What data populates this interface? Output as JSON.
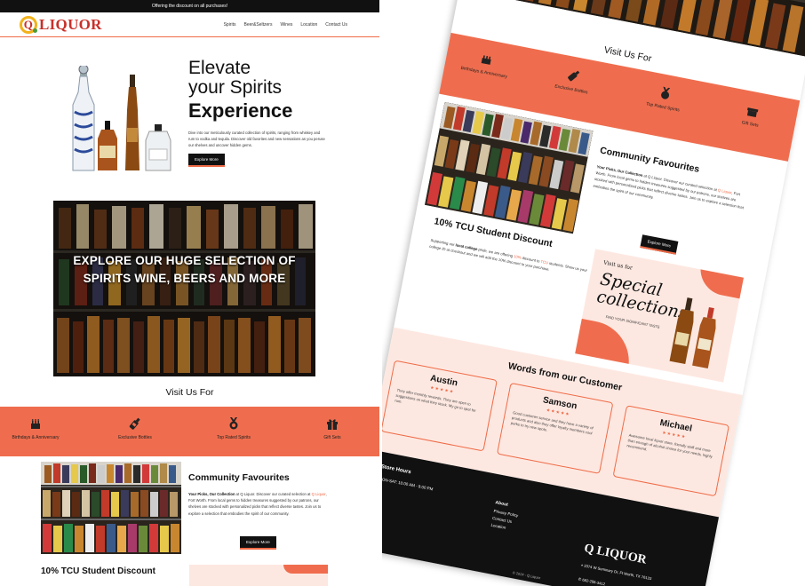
{
  "topbar": {
    "text": "Offering the discount on all purchases!"
  },
  "brand": {
    "name": "LIQUOR",
    "letter": "Q",
    "colors": {
      "accent": "#ef6d4e",
      "brand_red": "#c8302a",
      "dark": "#111111"
    }
  },
  "nav": [
    "Spirits",
    "Beer&Seltzers",
    "Wines",
    "Location",
    "Contact Us"
  ],
  "hero": {
    "line1": "Elevate",
    "line2": "your Spirits",
    "line3": "Experience",
    "body": "Dive into our meticulously curated collection of spirits, ranging from whiskey and rum to vodka and tequila. Discover old favorites and new sensations as you peruse our shelves and uncover hidden gems.",
    "button": "Explore More"
  },
  "banner": {
    "title": "EXPLORE OUR HUGE SELECTION OF SPIRITS WINE, BEERS AND MORE"
  },
  "visit": {
    "title": "Visit Us For",
    "items": [
      {
        "label": "Birthdays & Anniversary",
        "icon": "cake-icon"
      },
      {
        "label": "Exclusive Bottles",
        "icon": "bottle-icon"
      },
      {
        "label": "Top Rated Spirits",
        "icon": "medal-icon"
      },
      {
        "label": "Gift Sets",
        "icon": "gift-icon"
      }
    ]
  },
  "community": {
    "title": "Community Favourites",
    "lead": "Your Picks, Our Collection",
    "body_a": " at Q Liquor. Discover our curated selection at ",
    "link": "Q Liquor",
    "body_b": ", Fort Worth. From local gems to hidden treasures suggested by our patrons, our shelves are stocked with personalized picks that reflect diverse tastes. Join us to explore a selection that embodies the spirit of our community.",
    "button": "Explore More"
  },
  "tcu": {
    "title": "10% TCU Student Discount",
    "body_a": "Supporting our ",
    "bold": "local college",
    "body_b": " pride, we are offering ",
    "pct": "10%",
    "body_c": " discount to ",
    "link": "TCU",
    "body_d": " students. Show us your college ID at checkout and we will add the 10% discount to your purchase."
  },
  "special": {
    "kicker": "Visit us for",
    "title": "Special collections",
    "sub": "FIND YOUR SIGNIFICANT TASTE"
  },
  "testimonials": {
    "title": "Words from our Customer",
    "stars": "★★★★★",
    "items": [
      {
        "name": "Austin",
        "text": "They offer monthly rewards. They are open to suggestions on what they stock. My go to spot for rum."
      },
      {
        "name": "Samson",
        "text": "Good customer service and they have a variety of products and also they offer loyalty members cool perks to try new spots."
      },
      {
        "name": "Michael",
        "text": "Awesome local liquor store, friendly staff and more than enough of alcohol choice for your needs, highly recommend."
      }
    ]
  },
  "footer": {
    "hours_title": "Store Hours",
    "hours": "MON-SAT: 10:00 AM - 9:00 PM",
    "about_title": "About",
    "about_links": [
      "Privacy Policy",
      "Contact Us",
      "Location"
    ],
    "address": "3374 W Seminary Dr, Ft Worth, TX 76133",
    "phone": "682-255-3412",
    "copyright": "© 2024 - Q Liquor"
  }
}
